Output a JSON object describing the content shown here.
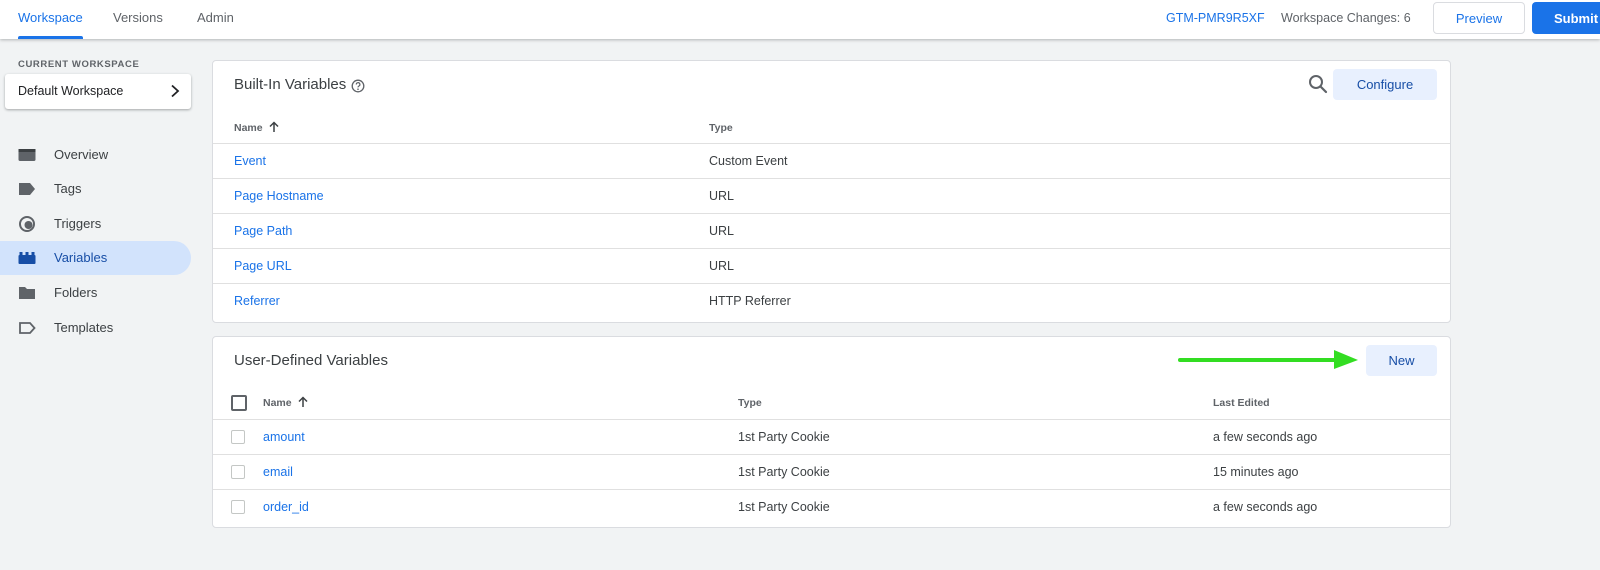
{
  "topbar": {
    "tabs": [
      {
        "label": "Workspace"
      },
      {
        "label": "Versions"
      },
      {
        "label": "Admin"
      }
    ],
    "container_id": "GTM-PMR9R5XF",
    "workspace_changes": "Workspace Changes: 6",
    "preview_label": "Preview",
    "submit_label": "Submit"
  },
  "sidebar": {
    "current_workspace_label": "CURRENT WORKSPACE",
    "workspace_name": "Default Workspace",
    "items": [
      {
        "label": "Overview",
        "icon": "overview-icon"
      },
      {
        "label": "Tags",
        "icon": "tag-icon"
      },
      {
        "label": "Triggers",
        "icon": "trigger-icon"
      },
      {
        "label": "Variables",
        "icon": "variables-icon"
      },
      {
        "label": "Folders",
        "icon": "folder-icon"
      },
      {
        "label": "Templates",
        "icon": "template-icon"
      }
    ],
    "active": "Variables"
  },
  "builtin": {
    "title": "Built-In Variables",
    "configure_label": "Configure",
    "columns": {
      "name": "Name",
      "type": "Type"
    },
    "rows": [
      {
        "name": "Event",
        "type": "Custom Event"
      },
      {
        "name": "Page Hostname",
        "type": "URL"
      },
      {
        "name": "Page Path",
        "type": "URL"
      },
      {
        "name": "Page URL",
        "type": "URL"
      },
      {
        "name": "Referrer",
        "type": "HTTP Referrer"
      }
    ]
  },
  "userdefined": {
    "title": "User-Defined Variables",
    "new_label": "New",
    "columns": {
      "name": "Name",
      "type": "Type",
      "last_edited": "Last Edited"
    },
    "rows": [
      {
        "name": "amount",
        "type": "1st Party Cookie",
        "last_edited": "a few seconds ago"
      },
      {
        "name": "email",
        "type": "1st Party Cookie",
        "last_edited": "15 minutes ago"
      },
      {
        "name": "order_id",
        "type": "1st Party Cookie",
        "last_edited": "a few seconds ago"
      }
    ]
  },
  "colors": {
    "accent": "#1a73e8",
    "active_nav_bg": "#d2e3fc",
    "tonal_button_bg": "#e8f0fe",
    "annotation_arrow": "#33dd22"
  }
}
